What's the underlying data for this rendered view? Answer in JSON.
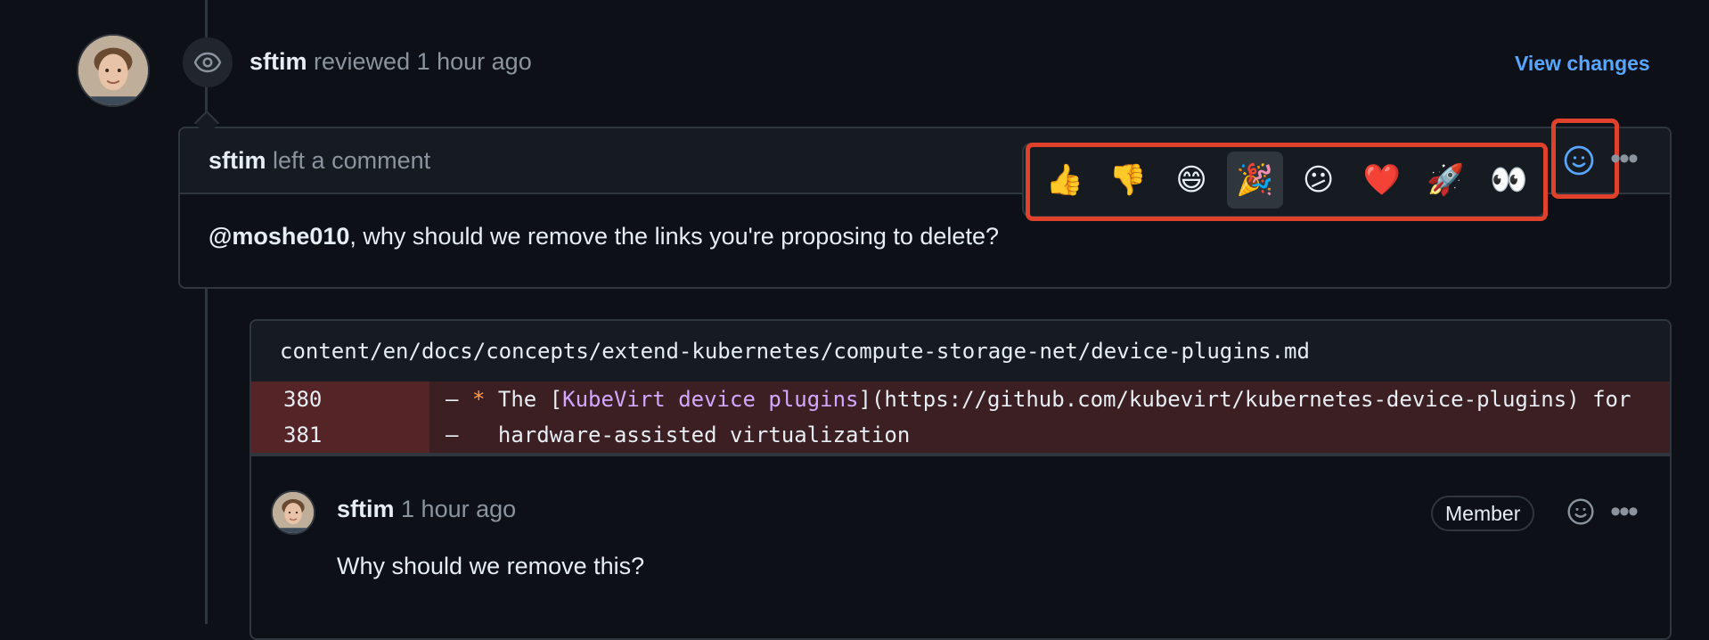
{
  "review": {
    "author": "sftim",
    "action": "reviewed",
    "time": "1 hour ago",
    "view_changes_label": "View changes"
  },
  "comment": {
    "author": "sftim",
    "action": "left a comment",
    "mention": "@moshe010",
    "text": ", why should we remove the links you're proposing to delete?"
  },
  "reactions": [
    {
      "name": "thumbs-up",
      "glyph": "👍"
    },
    {
      "name": "thumbs-down",
      "glyph": "👎"
    },
    {
      "name": "laugh",
      "glyph": "😄"
    },
    {
      "name": "hooray",
      "glyph": "🎉"
    },
    {
      "name": "confused",
      "glyph": "😕"
    },
    {
      "name": "heart",
      "glyph": "❤️"
    },
    {
      "name": "rocket",
      "glyph": "🚀"
    },
    {
      "name": "eyes",
      "glyph": "👀"
    }
  ],
  "diff": {
    "file_path": "content/en/docs/concepts/extend-kubernetes/compute-storage-net/device-plugins.md",
    "lines": [
      {
        "num": "380",
        "sign": "–",
        "star": "*",
        "pre": " The [",
        "link": "KubeVirt device plugins",
        "post": "](https://github.com/kubevirt/kubernetes-device-plugins) for"
      },
      {
        "num": "381",
        "sign": "–",
        "text": "  hardware-assisted virtualization"
      }
    ]
  },
  "reply": {
    "author": "sftim",
    "time": "1 hour ago",
    "badge": "Member",
    "text": "Why should we remove this?"
  },
  "colors": {
    "background": "#0d1117",
    "link": "#58a6ff",
    "highlight": "#e0412b",
    "deleted_line": "#3b1f22"
  }
}
